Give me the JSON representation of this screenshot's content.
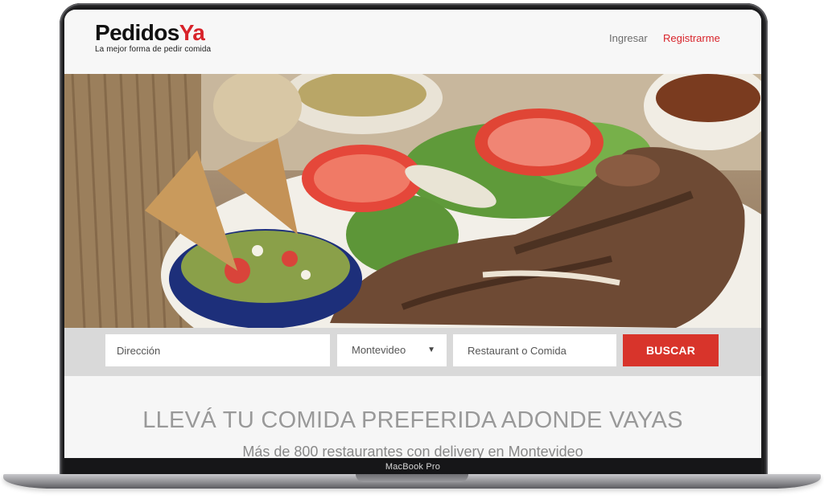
{
  "device": {
    "label": "MacBook Pro"
  },
  "header": {
    "logo_pedidos": "Pedidos",
    "logo_ya": "Ya",
    "tagline": "La mejor forma de pedir comida",
    "login_label": "Ingresar",
    "register_label": "Registrarme"
  },
  "search": {
    "address_placeholder": "Dirección",
    "city_value": "Montevideo",
    "food_placeholder": "Restaurant o Comida",
    "button_label": "BUSCAR"
  },
  "content": {
    "headline": "LLEVÁ TU COMIDA PREFERIDA ADONDE VAYAS",
    "subline": "Más de 800 restaurantes con delivery en Montevideo"
  },
  "colors": {
    "brand_red": "#d8232a",
    "button_red": "#d8342b",
    "search_band": "#d9d9d9"
  },
  "icons": {
    "city_dropdown": "caret-down-icon"
  }
}
